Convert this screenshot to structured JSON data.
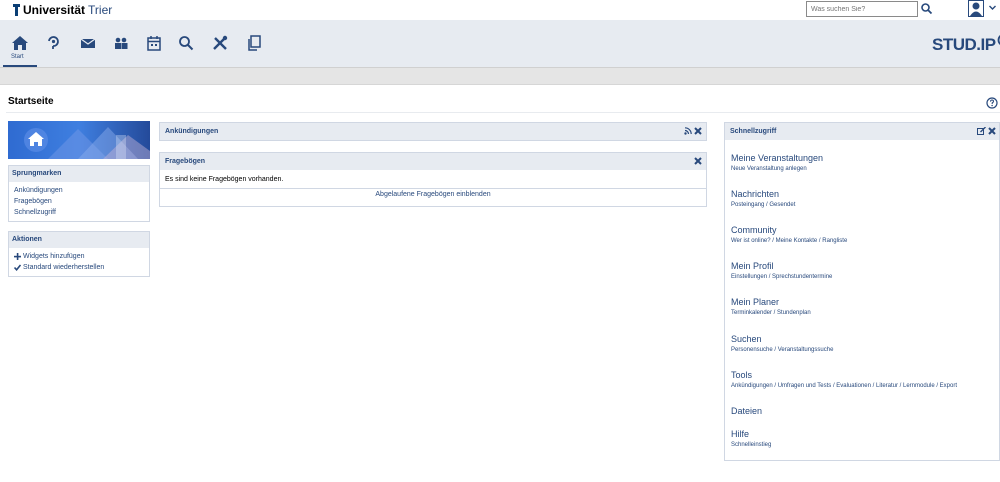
{
  "header": {
    "logo_name": "Universität",
    "logo_city": "Trier",
    "search_placeholder": "Was suchen Sie?"
  },
  "nav": {
    "start_label": "Start",
    "brand": "STUD.IP"
  },
  "page": {
    "title": "Startseite"
  },
  "sidebar": {
    "jump_title": "Sprungmarken",
    "jump_links": [
      "Ankündigungen",
      "Fragebögen",
      "Schnellzugriff"
    ],
    "actions_title": "Aktionen",
    "actions": [
      "Widgets hinzufügen",
      "Standard wiederherstellen"
    ]
  },
  "widgets": {
    "announcements_title": "Ankündigungen",
    "questionnaires_title": "Fragebögen",
    "questionnaires_empty": "Es sind keine Fragebögen vorhanden.",
    "questionnaires_footer": "Abgelaufene Fragebögen einblenden"
  },
  "quick": {
    "title": "Schnellzugriff",
    "items": [
      {
        "title": "Meine Veranstaltungen",
        "sub": "Neue Veranstaltung anlegen"
      },
      {
        "title": "Nachrichten",
        "sub": "Posteingang / Gesendet"
      },
      {
        "title": "Community",
        "sub": "Wer ist online? / Meine Kontakte / Rangliste"
      },
      {
        "title": "Mein Profil",
        "sub": "Einstellungen / Sprechstundentermine"
      },
      {
        "title": "Mein Planer",
        "sub": "Terminkalender / Stundenplan"
      },
      {
        "title": "Suchen",
        "sub": "Personensuche / Veranstaltungssuche"
      },
      {
        "title": "Tools",
        "sub": "Ankündigungen / Umfragen und Tests / Evaluationen / Literatur / Lernmodule / Export"
      },
      {
        "title": "Dateien",
        "sub": ""
      },
      {
        "title": "Hilfe",
        "sub": "Schnelleinstieg"
      }
    ]
  },
  "colors": {
    "brand_blue": "#28497c",
    "bar_bg": "#e7ebf1"
  }
}
